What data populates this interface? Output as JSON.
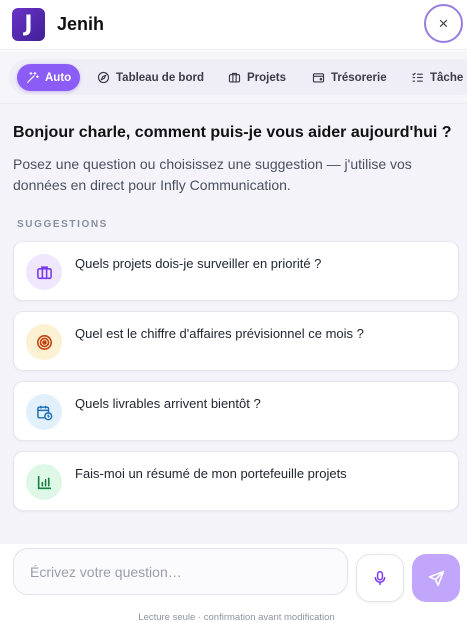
{
  "header": {
    "logo_letter": "J",
    "app_title": "Jenih",
    "close_icon": "×"
  },
  "tabs": [
    {
      "label": "Auto",
      "icon": "magic-wand-icon",
      "active": true
    },
    {
      "label": "Tableau de bord",
      "icon": "compass-icon",
      "active": false
    },
    {
      "label": "Projets",
      "icon": "briefcase-icon",
      "active": false
    },
    {
      "label": "Trésorerie",
      "icon": "wallet-icon",
      "active": false
    },
    {
      "label": "Tâche",
      "icon": "tasks-icon",
      "active": false
    }
  ],
  "main": {
    "greeting": "Bonjour charle, comment puis-je vous aider aujourd'hui ?",
    "subtitle": "Posez une question ou choisissez une suggestion — j'utilise vos données en direct pour Infly Communication.",
    "suggestions_label": "SUGGESTIONS",
    "suggestions": [
      {
        "text": "Quels projets dois-je surveiller en priorité ?",
        "icon": "briefcase-icon",
        "color": "#7c3aed",
        "bg": "#efe8fd"
      },
      {
        "text": "Quel est le chiffre d'affaires prévisionnel ce mois ?",
        "icon": "target-icon",
        "color": "#c2410c",
        "bg": "#fdf1d4"
      },
      {
        "text": "Quels livrables arrivent bientôt ?",
        "icon": "calendar-clock-icon",
        "color": "#1d6fb8",
        "bg": "#e2f0fc"
      },
      {
        "text": "Fais-moi un résumé de mon portefeuille projets",
        "icon": "bar-chart-icon",
        "color": "#15803d",
        "bg": "#def7e7"
      }
    ]
  },
  "composer": {
    "placeholder": "Écrivez votre question…",
    "footnote": "Lecture seule · confirmation avant modification"
  },
  "colors": {
    "accent": "#8b5cf6",
    "send_button": "#c2a6fb"
  }
}
